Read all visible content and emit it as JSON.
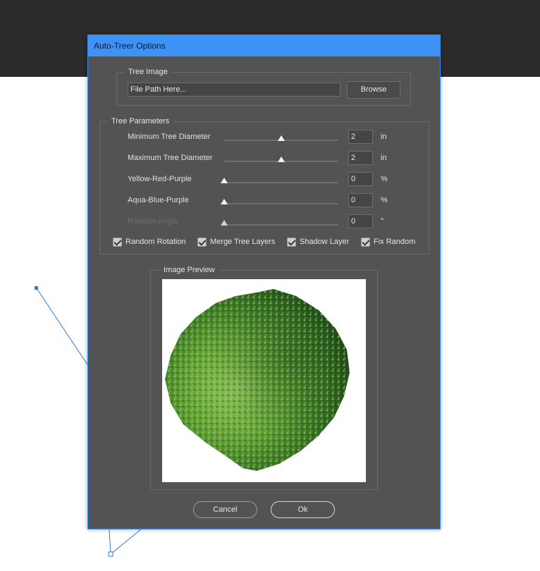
{
  "dialog": {
    "title": "Auto-Treer Options",
    "accent_color": "#3d93f5",
    "background_color": "#535353"
  },
  "tree_image": {
    "legend": "Tree Image",
    "file_path": "File Path Here...",
    "browse_label": "Browse"
  },
  "tree_parameters": {
    "legend": "Tree Parameters",
    "rows": [
      {
        "label": "Minimum Tree Diameter",
        "value": "2",
        "unit": "in",
        "slider_fraction": 0.5,
        "enabled": true
      },
      {
        "label": "Maximum Tree Diameter",
        "value": "2",
        "unit": "in",
        "slider_fraction": 0.5,
        "enabled": true
      },
      {
        "label": "Yellow-Red-Purple",
        "value": "0",
        "unit": "%",
        "slider_fraction": 0.0,
        "enabled": true
      },
      {
        "label": "Aqua-Blue-Purple",
        "value": "0",
        "unit": "%",
        "slider_fraction": 0.0,
        "enabled": true
      },
      {
        "label": "Rotation Angle",
        "value": "0",
        "unit": "°",
        "slider_fraction": 0.0,
        "enabled": false
      }
    ],
    "checkboxes": [
      {
        "label": "Random Rotation",
        "checked": true
      },
      {
        "label": "Merge Tree Layers",
        "checked": true
      },
      {
        "label": "Shadow Layer",
        "checked": true
      },
      {
        "label": "Fix Random",
        "checked": true
      }
    ]
  },
  "image_preview": {
    "legend": "Image Preview",
    "image": "tree-canopy-top-view"
  },
  "buttons": {
    "cancel": "Cancel",
    "ok": "Ok"
  }
}
